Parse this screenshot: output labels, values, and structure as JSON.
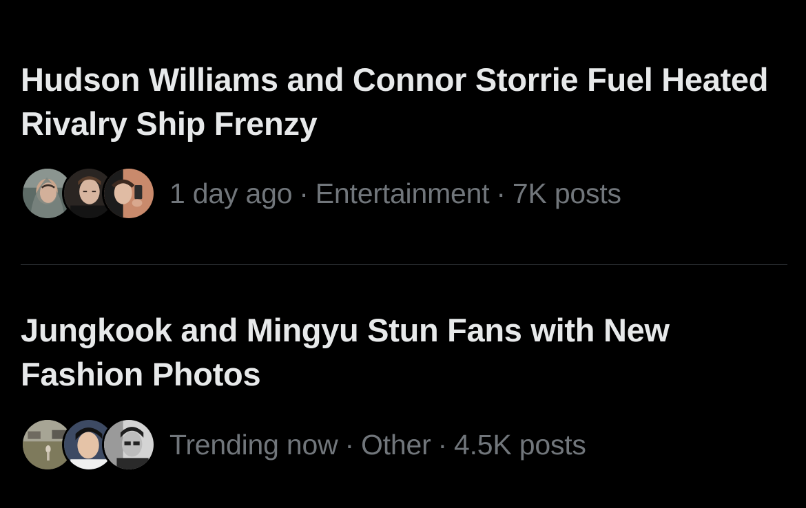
{
  "trends": [
    {
      "headline": "Hudson Williams and Connor Storrie Fuel Heated Rivalry Ship Frenzy",
      "time": "1 day ago",
      "category": "Entertainment",
      "posts": "7K posts",
      "separator": "·"
    },
    {
      "headline": "Jungkook and Mingyu Stun Fans with New Fashion Photos",
      "time": "Trending now",
      "category": "Other",
      "posts": "4.5K posts",
      "separator": "·"
    }
  ],
  "colors": {
    "background": "#000000",
    "headline": "#e7e9ea",
    "meta": "#71767b",
    "divider": "#2f3336"
  }
}
